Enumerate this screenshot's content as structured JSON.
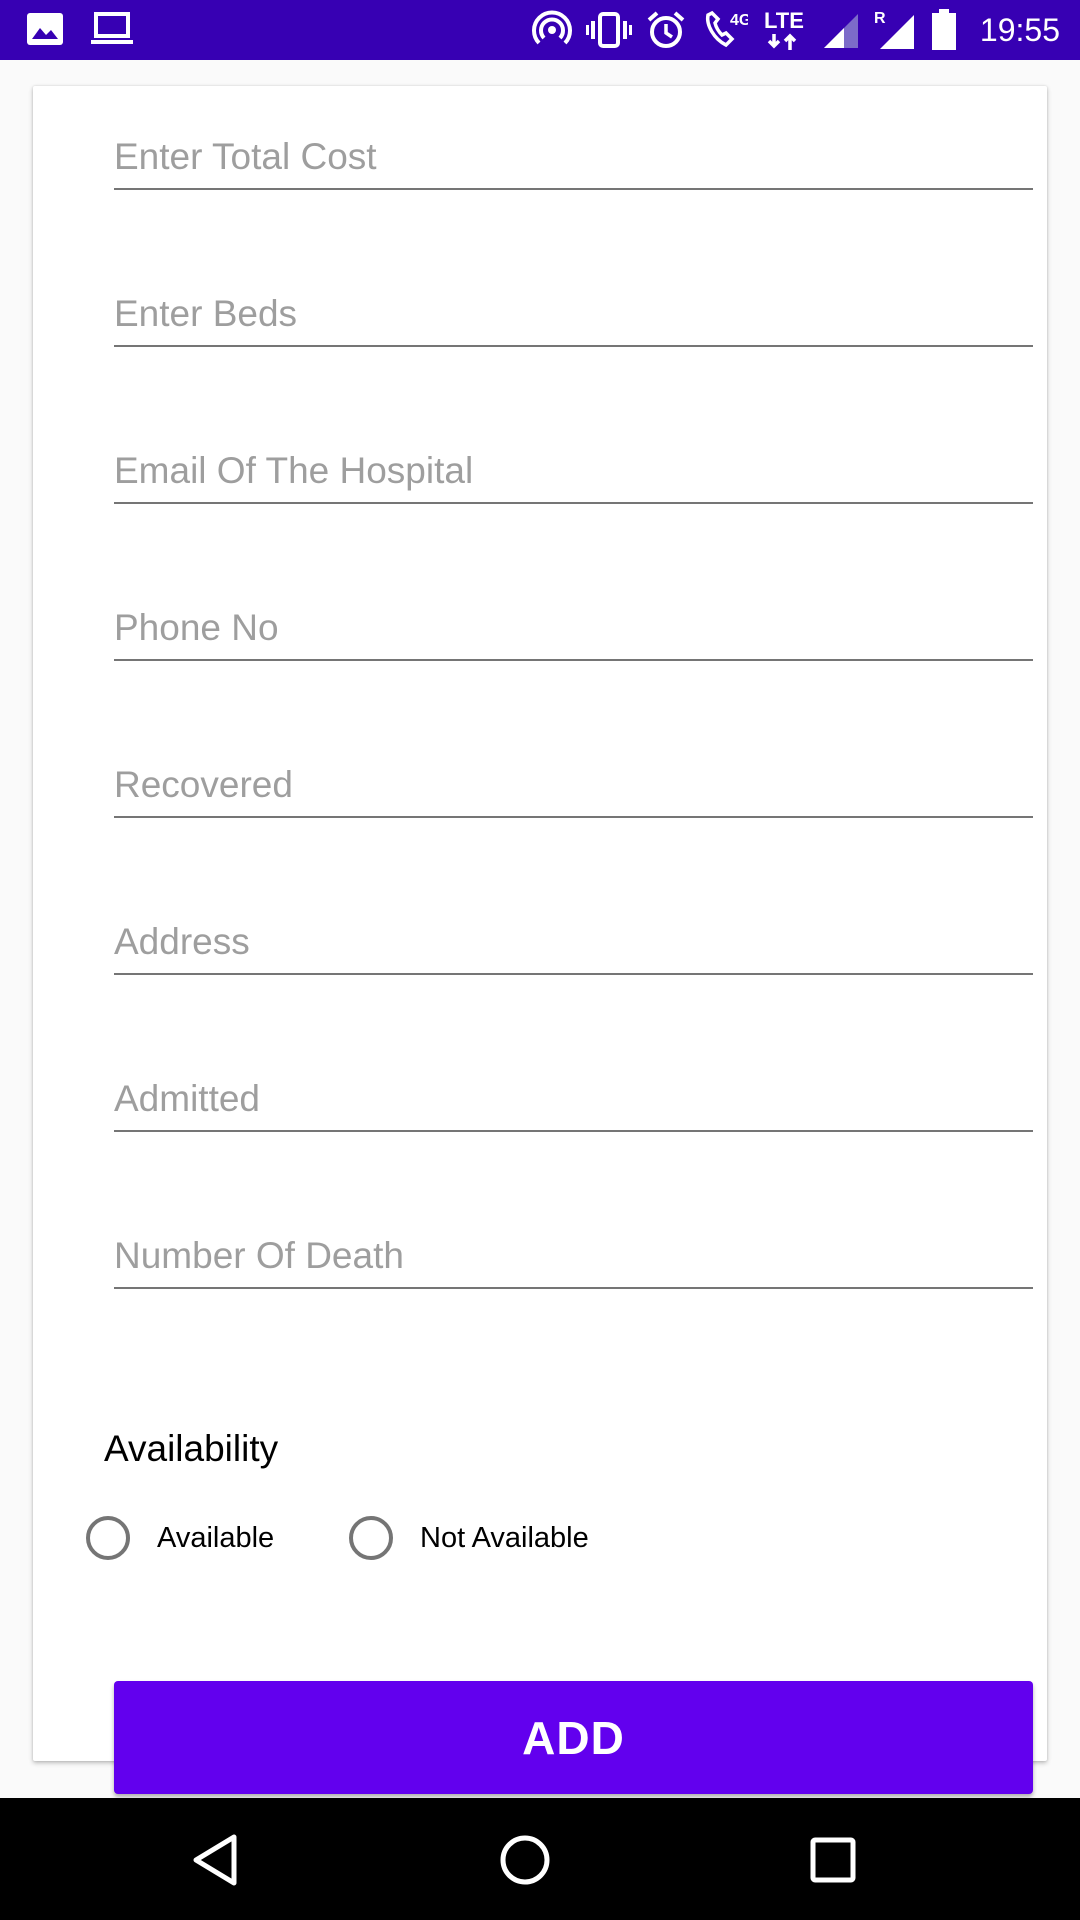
{
  "status_bar": {
    "time": "19:55",
    "background": "#3700b3",
    "left_icons": [
      "image-icon",
      "laptop-icon"
    ],
    "right_icons": [
      "hotspot-icon",
      "vibrate-icon",
      "alarm-icon",
      "wifi-calling-icon",
      "lte-icon",
      "signal-icon",
      "roaming-signal-icon",
      "battery-icon"
    ],
    "network_4g": "4G",
    "network_lte": "LTE",
    "roaming_mark": "R"
  },
  "form": {
    "fields": [
      {
        "placeholder": "Enter Total Cost",
        "value": ""
      },
      {
        "placeholder": "Enter Beds",
        "value": ""
      },
      {
        "placeholder": "Email Of The Hospital",
        "value": ""
      },
      {
        "placeholder": "Phone No",
        "value": ""
      },
      {
        "placeholder": "Recovered",
        "value": ""
      },
      {
        "placeholder": "Address",
        "value": ""
      },
      {
        "placeholder": "Admitted",
        "value": ""
      },
      {
        "placeholder": "Number Of Death",
        "value": ""
      }
    ],
    "availability_label": "Availability",
    "options": [
      {
        "label": "Available",
        "selected": false
      },
      {
        "label": "Not Available",
        "selected": false
      }
    ],
    "submit_label": "ADD",
    "accent": "#6200ee"
  },
  "nav_bar": {
    "buttons": [
      "back-icon",
      "home-icon",
      "recents-icon"
    ]
  }
}
